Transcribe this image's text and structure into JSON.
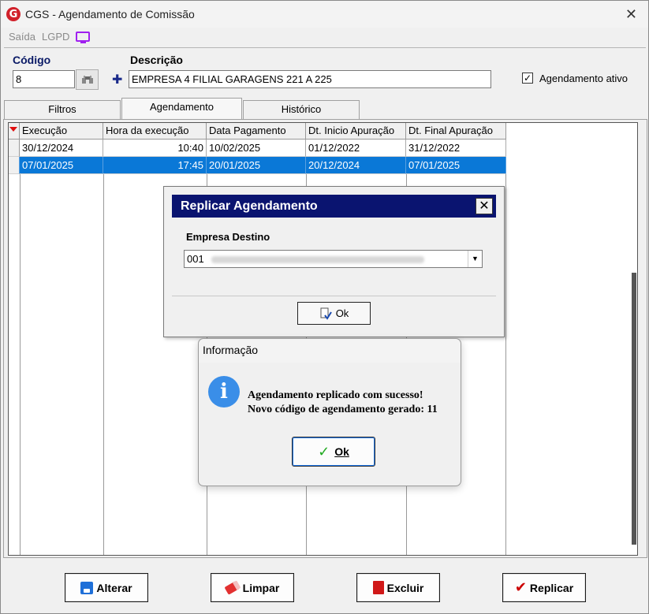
{
  "window": {
    "title": "CGS - Agendamento de Comissão",
    "logo_letter": "G",
    "close_glyph": "✕"
  },
  "menu": {
    "items": [
      "Saída",
      "LGPD"
    ]
  },
  "form": {
    "codigo_label": "Código",
    "codigo_value": "8",
    "descricao_label": "Descrição",
    "descricao_value": "EMPRESA 4 FILIAL GARAGENS 221 A 225",
    "ativo_label": "Agendamento ativo",
    "ativo_checked": true
  },
  "tabs": [
    {
      "label": "Filtros",
      "active": false
    },
    {
      "label": "Agendamento",
      "active": true
    },
    {
      "label": "Histórico",
      "active": false
    }
  ],
  "grid": {
    "columns": [
      "Execução",
      "Hora da execução",
      "Data Pagamento",
      "Dt. Inicio Apuração",
      "Dt. Final Apuração"
    ],
    "rows": [
      {
        "execucao": "30/12/2024",
        "hora": "10:40",
        "pagamento": "10/02/2025",
        "inicio": "01/12/2022",
        "final": "31/12/2022",
        "selected": false
      },
      {
        "execucao": "07/01/2025",
        "hora": "17:45",
        "pagamento": "20/01/2025",
        "inicio": "20/12/2024",
        "final": "07/01/2025",
        "selected": true
      }
    ]
  },
  "actions": {
    "alterar": "Alterar",
    "limpar": "Limpar",
    "excluir": "Excluir",
    "replicar": "Replicar"
  },
  "replicar_dialog": {
    "title": "Replicar Agendamento",
    "close_glyph": "✕",
    "empresa_label": "Empresa Destino",
    "empresa_value": "001",
    "ok_label": "Ok"
  },
  "info_dialog": {
    "title": "Informação",
    "icon_glyph": "i",
    "message_line1": "Agendamento replicado com sucesso!",
    "message_line2": "Novo código de agendamento gerado: 11",
    "ok_label": "Ok"
  },
  "colors": {
    "selection": "#0a78d7",
    "dialog_title_bg": "#0a1470",
    "info_icon": "#3a8ee8",
    "logo": "#d1202a"
  }
}
